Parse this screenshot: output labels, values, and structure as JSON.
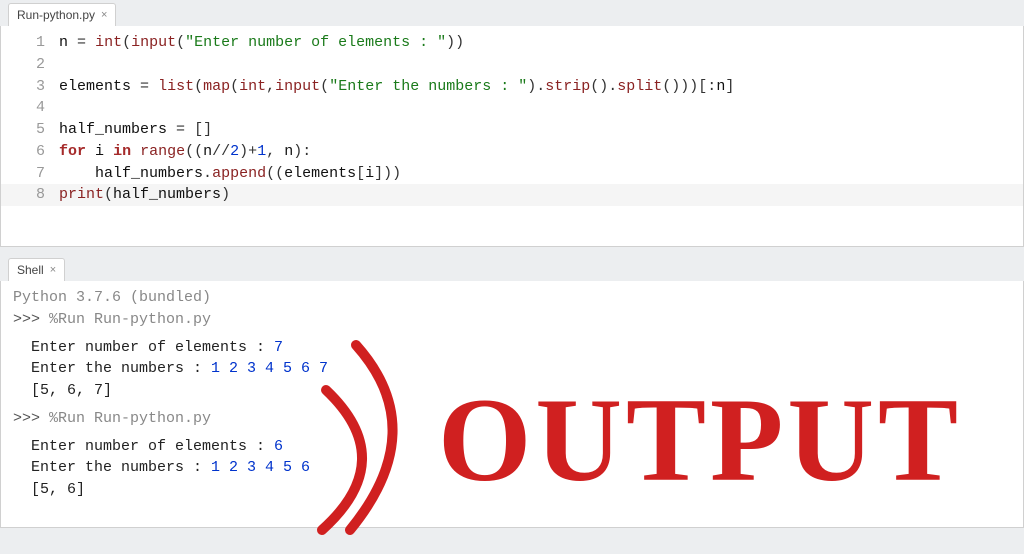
{
  "editor": {
    "tab_label": "Run-python.py",
    "lines": [
      "n = int(input(\"Enter number of elements : \"))",
      "",
      "elements = list(map(int,input(\"Enter the numbers : \").strip().split()))[:n]",
      "",
      "half_numbers = []",
      "for i in range((n//2)+1, n):",
      "    half_numbers.append((elements[i]))",
      "print(half_numbers)"
    ],
    "cursor_line": 8
  },
  "shell": {
    "tab_label": "Shell",
    "version_line": "Python 3.7.6 (bundled)",
    "sessions": [
      {
        "command": "%Run Run-python.py",
        "io": [
          {
            "prompt": "Enter number of elements : ",
            "input": "7"
          },
          {
            "prompt": "Enter the numbers : ",
            "input": "1 2 3 4 5 6 7"
          }
        ],
        "result": "[5, 6, 7]"
      },
      {
        "command": "%Run Run-python.py",
        "io": [
          {
            "prompt": "Enter number of elements : ",
            "input": "6"
          },
          {
            "prompt": "Enter the numbers : ",
            "input": "1 2 3 4 5 6"
          }
        ],
        "result": "[5, 6]"
      }
    ]
  },
  "annotation": {
    "text": "OUTPUT",
    "color": "#d02020"
  }
}
